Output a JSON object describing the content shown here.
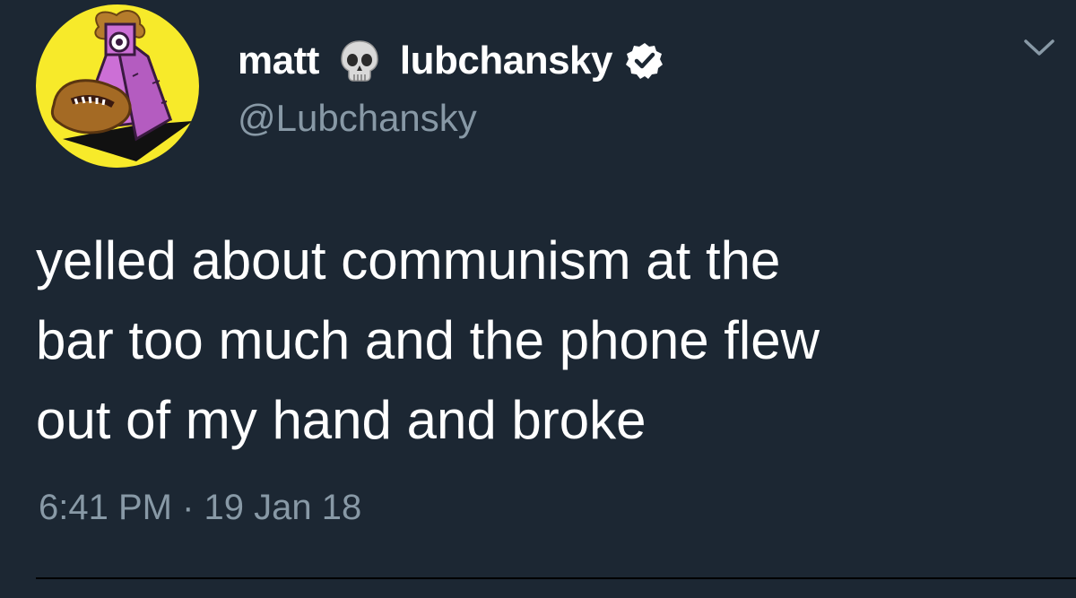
{
  "tweet": {
    "author": {
      "name_first": "matt",
      "name_emoji": "skull-icon",
      "name_last": "lubchansky",
      "verified": true,
      "handle": "@Lubchansky"
    },
    "text": "yelled about communism at the\nbar too much and the phone flew\nout of my hand and broke",
    "time": "6:41 PM",
    "separator": "·",
    "date": "19 Jan 18",
    "menu_icon": "chevron-down-icon"
  },
  "colors": {
    "background": "#1c2733",
    "primary_text": "#ffffff",
    "secondary_text": "#8899a6",
    "avatar_background": "#f7ea2a",
    "avatar_figure": "#cc6fd6"
  }
}
